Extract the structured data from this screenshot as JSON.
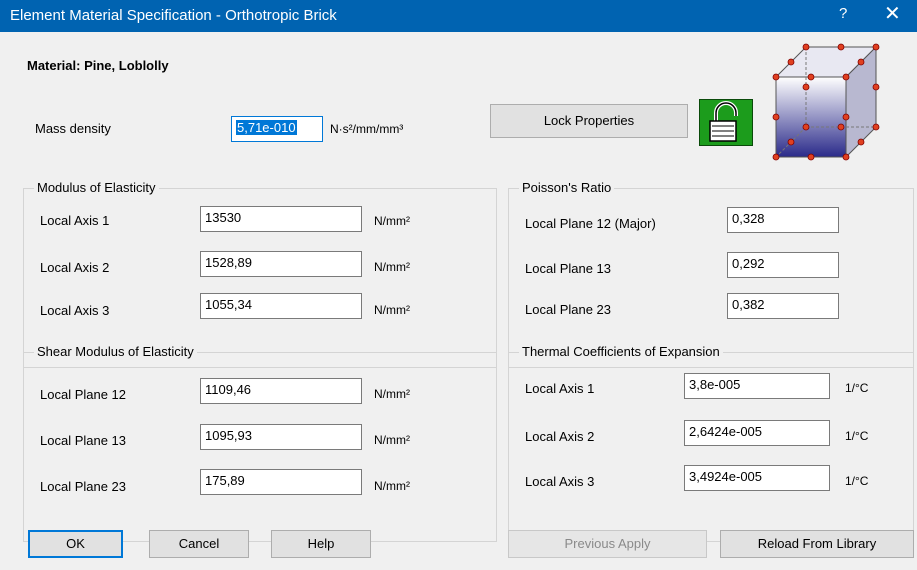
{
  "window": {
    "title": "Element Material Specification - Orthotropic Brick",
    "help_symbol": "?",
    "close_symbol": "✕"
  },
  "material": {
    "label": "Material: Pine, Loblolly"
  },
  "mass_density": {
    "label": "Mass density",
    "value": "5,71e-010",
    "unit": "N·s²/mm/mm³"
  },
  "lock": {
    "button_label": "Lock Properties",
    "icon": "padlock-icon"
  },
  "elasticity": {
    "title": "Modulus of Elasticity",
    "rows": [
      {
        "label": "Local Axis 1",
        "value": "13530",
        "unit": "N/mm²"
      },
      {
        "label": "Local Axis 2",
        "value": "1528,89",
        "unit": "N/mm²"
      },
      {
        "label": "Local Axis 3",
        "value": "1055,34",
        "unit": "N/mm²"
      }
    ]
  },
  "poisson": {
    "title": "Poisson's Ratio",
    "rows": [
      {
        "label": "Local Plane 12 (Major)",
        "value": "0,328"
      },
      {
        "label": "Local Plane 13",
        "value": "0,292"
      },
      {
        "label": "Local Plane 23",
        "value": "0,382"
      }
    ]
  },
  "shear": {
    "title": "Shear Modulus of Elasticity",
    "rows": [
      {
        "label": "Local Plane 12",
        "value": "1109,46",
        "unit": "N/mm²"
      },
      {
        "label": "Local Plane 13",
        "value": "1095,93",
        "unit": "N/mm²"
      },
      {
        "label": "Local Plane 23",
        "value": "175,89",
        "unit": "N/mm²"
      }
    ]
  },
  "thermal": {
    "title": "Thermal Coefficients of Expansion",
    "rows": [
      {
        "label": "Local Axis 1",
        "value": "3,8e-005",
        "unit": "1/°C"
      },
      {
        "label": "Local Axis 2",
        "value": "2,6424e-005",
        "unit": "1/°C"
      },
      {
        "label": "Local Axis 3",
        "value": "3,4924e-005",
        "unit": "1/°C"
      }
    ]
  },
  "buttons": {
    "ok": "OK",
    "cancel": "Cancel",
    "help": "Help",
    "previous_apply": "Previous Apply",
    "reload": "Reload From Library"
  },
  "colors": {
    "titlebar": "#0063b1",
    "dialog_bg": "#f0f0f0",
    "accent": "#0078d7",
    "lock_bg": "#1c9c1c"
  }
}
